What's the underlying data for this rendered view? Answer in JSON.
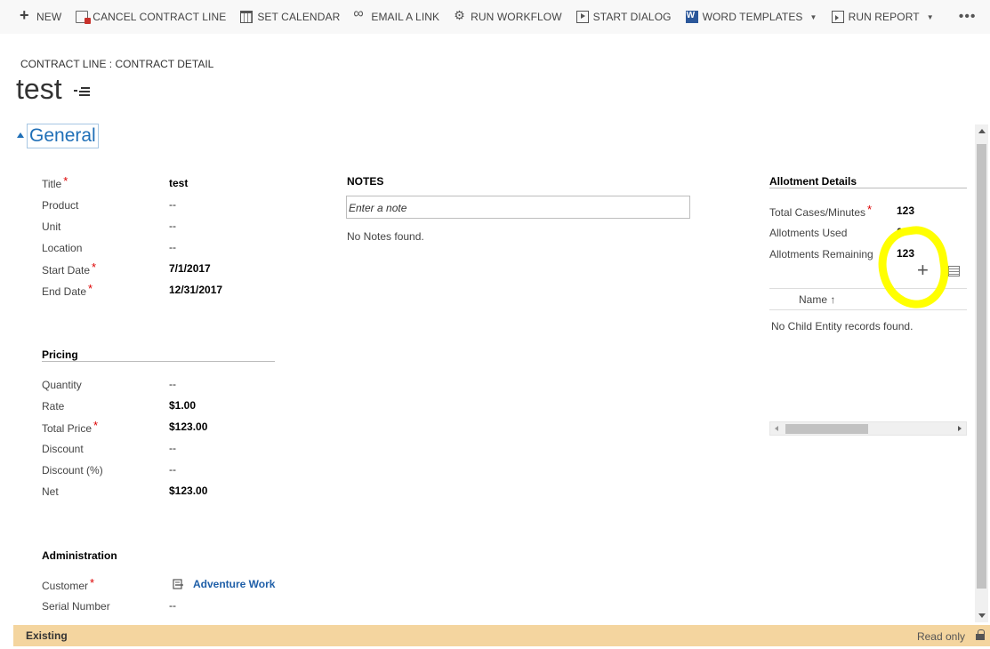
{
  "command_bar": {
    "items": [
      {
        "label": "NEW",
        "icon": "plus-icon"
      },
      {
        "label": "CANCEL CONTRACT LINE",
        "icon": "cancel-document-icon"
      },
      {
        "label": "SET CALENDAR",
        "icon": "calendar-icon"
      },
      {
        "label": "EMAIL A LINK",
        "icon": "link-icon"
      },
      {
        "label": "RUN WORKFLOW",
        "icon": "workflow-icon"
      },
      {
        "label": "START DIALOG",
        "icon": "dialog-icon"
      },
      {
        "label": "WORD TEMPLATES",
        "icon": "word-icon",
        "dropdown": true
      },
      {
        "label": "RUN REPORT",
        "icon": "report-icon",
        "dropdown": true
      }
    ],
    "more": "•••"
  },
  "header": {
    "breadcrumb": "CONTRACT LINE : CONTRACT DETAIL",
    "title": "test"
  },
  "section": {
    "title": "General"
  },
  "general_fields": [
    {
      "label": "Title",
      "value": "test",
      "required": true,
      "bold": true
    },
    {
      "label": "Product",
      "value": "--"
    },
    {
      "label": "Unit",
      "value": "--"
    },
    {
      "label": "Location",
      "value": "--"
    },
    {
      "label": "Start Date",
      "value": "7/1/2017",
      "required": true,
      "bold": true
    },
    {
      "label": "End Date",
      "value": "12/31/2017",
      "required": true,
      "bold": true
    }
  ],
  "pricing": {
    "title": "Pricing",
    "fields": [
      {
        "label": "Quantity",
        "value": "--"
      },
      {
        "label": "Rate",
        "value": "$1.00",
        "bold": true
      },
      {
        "label": "Total Price",
        "value": "$123.00",
        "required": true,
        "bold": true
      },
      {
        "label": "Discount",
        "value": "--"
      },
      {
        "label": "Discount (%)",
        "value": "--"
      },
      {
        "label": "Net",
        "value": "$123.00",
        "bold": true
      }
    ]
  },
  "administration": {
    "title": "Administration",
    "customer_label": "Customer",
    "customer_value": "Adventure Works (sample)",
    "serial_label": "Serial Number",
    "serial_value": "--"
  },
  "notes": {
    "title": "NOTES",
    "placeholder": "Enter a note",
    "empty": "No Notes found."
  },
  "allotment": {
    "title": "Allotment Details",
    "fields": [
      {
        "label": "Total Cases/Minutes",
        "value": "123",
        "required": true
      },
      {
        "label": "Allotments Used",
        "value": "0"
      },
      {
        "label": "Allotments Remaining",
        "value": "123"
      }
    ],
    "grid_column": "Name ↑",
    "grid_empty": "No Child Entity records found."
  },
  "status_bar": {
    "state": "Existing",
    "mode": "Read only"
  },
  "colors": {
    "accent": "#1f6fb7",
    "status_bar": "#f4d59f",
    "highlight": "#ffff00",
    "required": "#dd0000"
  }
}
